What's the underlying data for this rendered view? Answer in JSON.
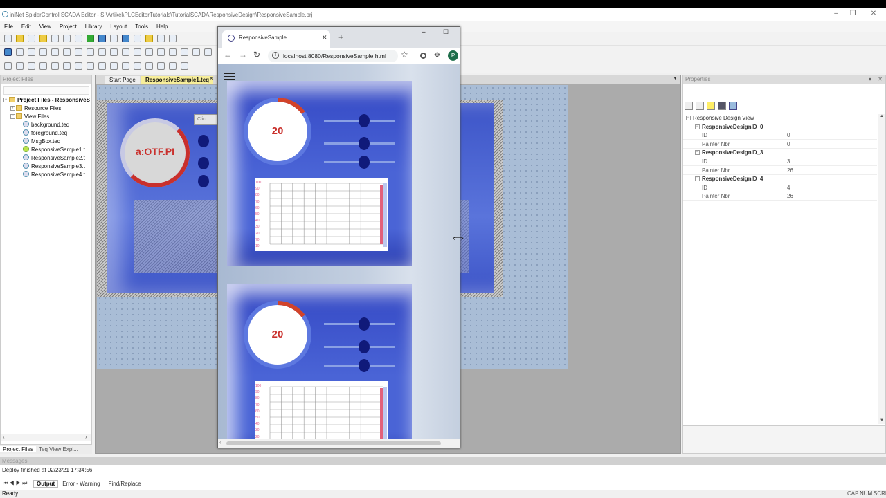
{
  "app": {
    "title": "iniNet SpiderControl SCADA Editor - S:\\Artikel\\PLCEditorTutorials\\TutorialSCADAResponsiveDesign\\ResponsiveSample.prj",
    "menu": [
      "File",
      "Edit",
      "View",
      "Project",
      "Library",
      "Layout",
      "Tools",
      "Help"
    ]
  },
  "project_panel": {
    "title": "Project Files",
    "tree": [
      {
        "label": "Project Files - ResponsiveS",
        "indent": 0,
        "kind": "root"
      },
      {
        "label": "Resource Files",
        "indent": 1,
        "kind": "folder"
      },
      {
        "label": "View Files",
        "indent": 1,
        "kind": "folder"
      },
      {
        "label": "background.teq",
        "indent": 2,
        "kind": "file"
      },
      {
        "label": "foreground.teq",
        "indent": 2,
        "kind": "file"
      },
      {
        "label": "MsgBox.teq",
        "indent": 2,
        "kind": "file"
      },
      {
        "label": "ResponsiveSample1.t",
        "indent": 2,
        "kind": "file-active"
      },
      {
        "label": "ResponsiveSample2.t",
        "indent": 2,
        "kind": "file"
      },
      {
        "label": "ResponsiveSample3.t",
        "indent": 2,
        "kind": "file"
      },
      {
        "label": "ResponsiveSample4.t",
        "indent": 2,
        "kind": "file"
      }
    ],
    "bottom_tabs": [
      "Project Files",
      "Teq View Expl..."
    ]
  },
  "editor": {
    "tabs": [
      "Start Page",
      "ResponsiveSample1.teq"
    ],
    "gauge_text": "a:OTF.PI",
    "button_text": "Clic"
  },
  "browser": {
    "tab_title": "ResponsiveSample",
    "url": "localhost:8080/ResponsiveSample.html",
    "avatar_letter": "P",
    "cards": [
      {
        "gauge_value": "20",
        "gauge_fill": 0.15
      },
      {
        "gauge_value": "20",
        "gauge_fill": 0.15
      }
    ],
    "plot_ticks": [
      "100",
      "90",
      "80",
      "70",
      "60",
      "50",
      "40",
      "30",
      "20",
      "70",
      "10"
    ]
  },
  "properties": {
    "title": "Properties",
    "rows": [
      {
        "key": "Responsive Design View",
        "value": "",
        "type": "root"
      },
      {
        "key": "ResponsiveDesignID_0",
        "value": "",
        "type": "grp"
      },
      {
        "key": "ID",
        "value": "0",
        "type": "row"
      },
      {
        "key": "Painter Nbr",
        "value": "0",
        "type": "row"
      },
      {
        "key": "ResponsiveDesignID_3",
        "value": "",
        "type": "grp"
      },
      {
        "key": "ID",
        "value": "3",
        "type": "row"
      },
      {
        "key": "Painter Nbr",
        "value": "26",
        "type": "row"
      },
      {
        "key": "ResponsiveDesignID_4",
        "value": "",
        "type": "grp"
      },
      {
        "key": "ID",
        "value": "4",
        "type": "row"
      },
      {
        "key": "Painter Nbr",
        "value": "26",
        "type": "row"
      }
    ]
  },
  "messages": {
    "title": "Messages",
    "text": "Deploy finished at  02/23/21 17:34:56",
    "tabs": [
      "Output",
      "Error - Warning",
      "Find/Replace"
    ]
  },
  "status": {
    "left": "Ready",
    "right": [
      "CAP",
      "NUM",
      "SCRL"
    ]
  },
  "colors": {
    "card_blue": "#4a64d6",
    "knob": "#101a7a",
    "gauge_red": "#c9302c"
  }
}
